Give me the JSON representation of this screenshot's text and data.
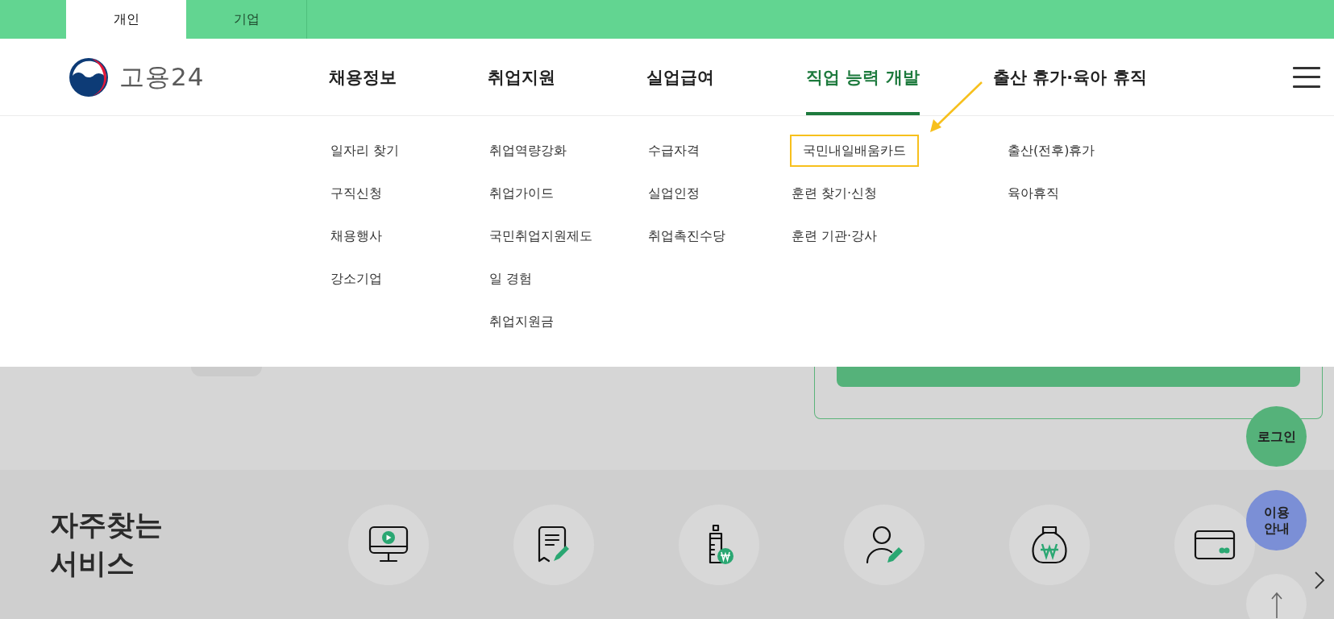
{
  "top_tabs": [
    {
      "label": "개인",
      "selected": true
    },
    {
      "label": "기업",
      "selected": false
    }
  ],
  "logo": {
    "text": "고용24"
  },
  "nav": [
    {
      "label": "채용정보",
      "selected": false,
      "submenu": [
        {
          "label": "일자리 찾기",
          "highlighted": false
        },
        {
          "label": "구직신청",
          "highlighted": false
        },
        {
          "label": "채용행사",
          "highlighted": false
        },
        {
          "label": "강소기업",
          "highlighted": false
        }
      ]
    },
    {
      "label": "취업지원",
      "selected": false,
      "submenu": [
        {
          "label": "취업역량강화",
          "highlighted": false
        },
        {
          "label": "취업가이드",
          "highlighted": false
        },
        {
          "label": "국민취업지원제도",
          "highlighted": false
        },
        {
          "label": "일 경험",
          "highlighted": false
        },
        {
          "label": "취업지원금",
          "highlighted": false
        }
      ]
    },
    {
      "label": "실업급여",
      "selected": false,
      "submenu": [
        {
          "label": "수급자격",
          "highlighted": false
        },
        {
          "label": "실업인정",
          "highlighted": false
        },
        {
          "label": "취업촉진수당",
          "highlighted": false
        }
      ]
    },
    {
      "label": "직업 능력 개발",
      "selected": true,
      "submenu": [
        {
          "label": "국민내일배움카드",
          "highlighted": true
        },
        {
          "label": "훈련 찾기·신청",
          "highlighted": false
        },
        {
          "label": "훈련 기관·강사",
          "highlighted": false
        }
      ]
    },
    {
      "label": "출산 휴가·육아 휴직",
      "selected": false,
      "submenu": [
        {
          "label": "출산(전후)휴가",
          "highlighted": false
        },
        {
          "label": "육아휴직",
          "highlighted": false
        }
      ]
    }
  ],
  "frequent_services": {
    "title": "자주찾는\n서비스",
    "items": [
      {
        "kind": "monitor"
      },
      {
        "kind": "document"
      },
      {
        "kind": "bottle"
      },
      {
        "kind": "person"
      },
      {
        "kind": "moneybag"
      },
      {
        "kind": "card"
      }
    ]
  },
  "floating_buttons": [
    {
      "label": "로그인",
      "kind": "login"
    },
    {
      "label": "이용\n안내",
      "kind": "guide"
    },
    {
      "kind": "top"
    }
  ]
}
